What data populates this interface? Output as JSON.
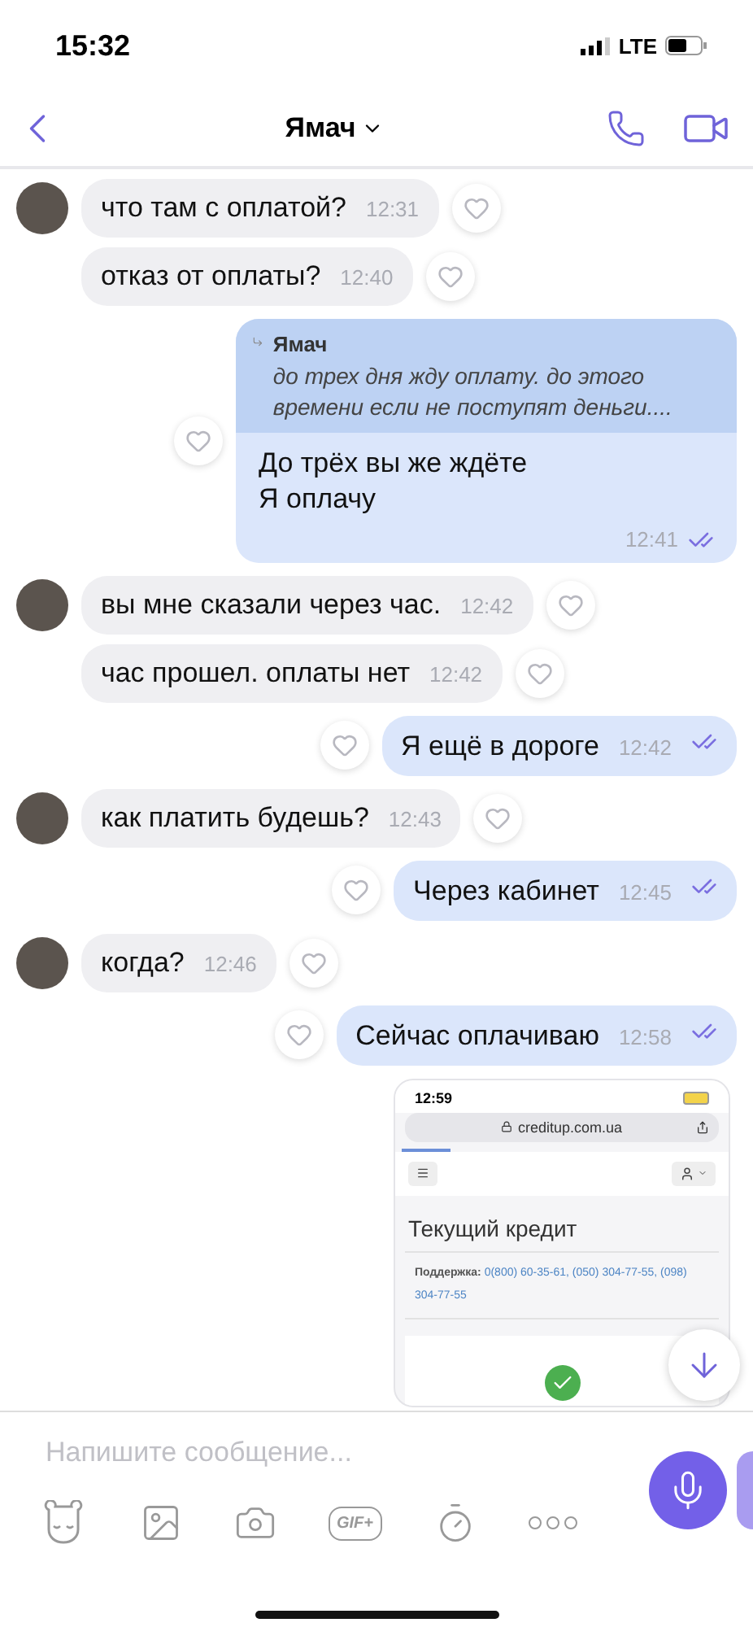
{
  "status_bar": {
    "time": "15:32",
    "network": "LTE"
  },
  "header": {
    "title": "Ямач"
  },
  "messages": [
    {
      "kind": "incoming",
      "avatar": true,
      "text": "что там с оплатой?",
      "time": "12:31"
    },
    {
      "kind": "incoming",
      "avatar": false,
      "text": "отказ от оплаты?",
      "time": "12:40"
    },
    {
      "kind": "reply",
      "quote_author": "Ямач",
      "quote_text": "до трех дня жду оплату. до этого времени если не поступят деньги....",
      "lines": [
        "До трёх вы же ждёте",
        "Я оплачу"
      ],
      "time": "12:41"
    },
    {
      "kind": "incoming",
      "avatar": true,
      "text": "вы мне сказали через час.",
      "time": "12:42"
    },
    {
      "kind": "incoming",
      "avatar": false,
      "text": "час прошел. оплаты нет",
      "time": "12:42"
    },
    {
      "kind": "outgoing",
      "text": "Я ещё в дороге",
      "time": "12:42"
    },
    {
      "kind": "incoming",
      "avatar": true,
      "text": "как платить будешь?",
      "time": "12:43"
    },
    {
      "kind": "outgoing",
      "text": "Через кабинет",
      "time": "12:45"
    },
    {
      "kind": "incoming",
      "avatar": true,
      "text": "когда?",
      "time": "12:46"
    },
    {
      "kind": "outgoing",
      "text": "Сейчас оплачиваю",
      "time": "12:58"
    },
    {
      "kind": "screenshot",
      "time": "12:59",
      "url": "creditup.com.ua",
      "heading": "Текущий кредит",
      "support_label": "Поддержка:",
      "phones": "0(800) 60-35-61, (050) 304-77-55, (098) 304-77-55"
    }
  ],
  "composer": {
    "placeholder": "Напишите сообщение...",
    "gif_label": "GIF+"
  }
}
